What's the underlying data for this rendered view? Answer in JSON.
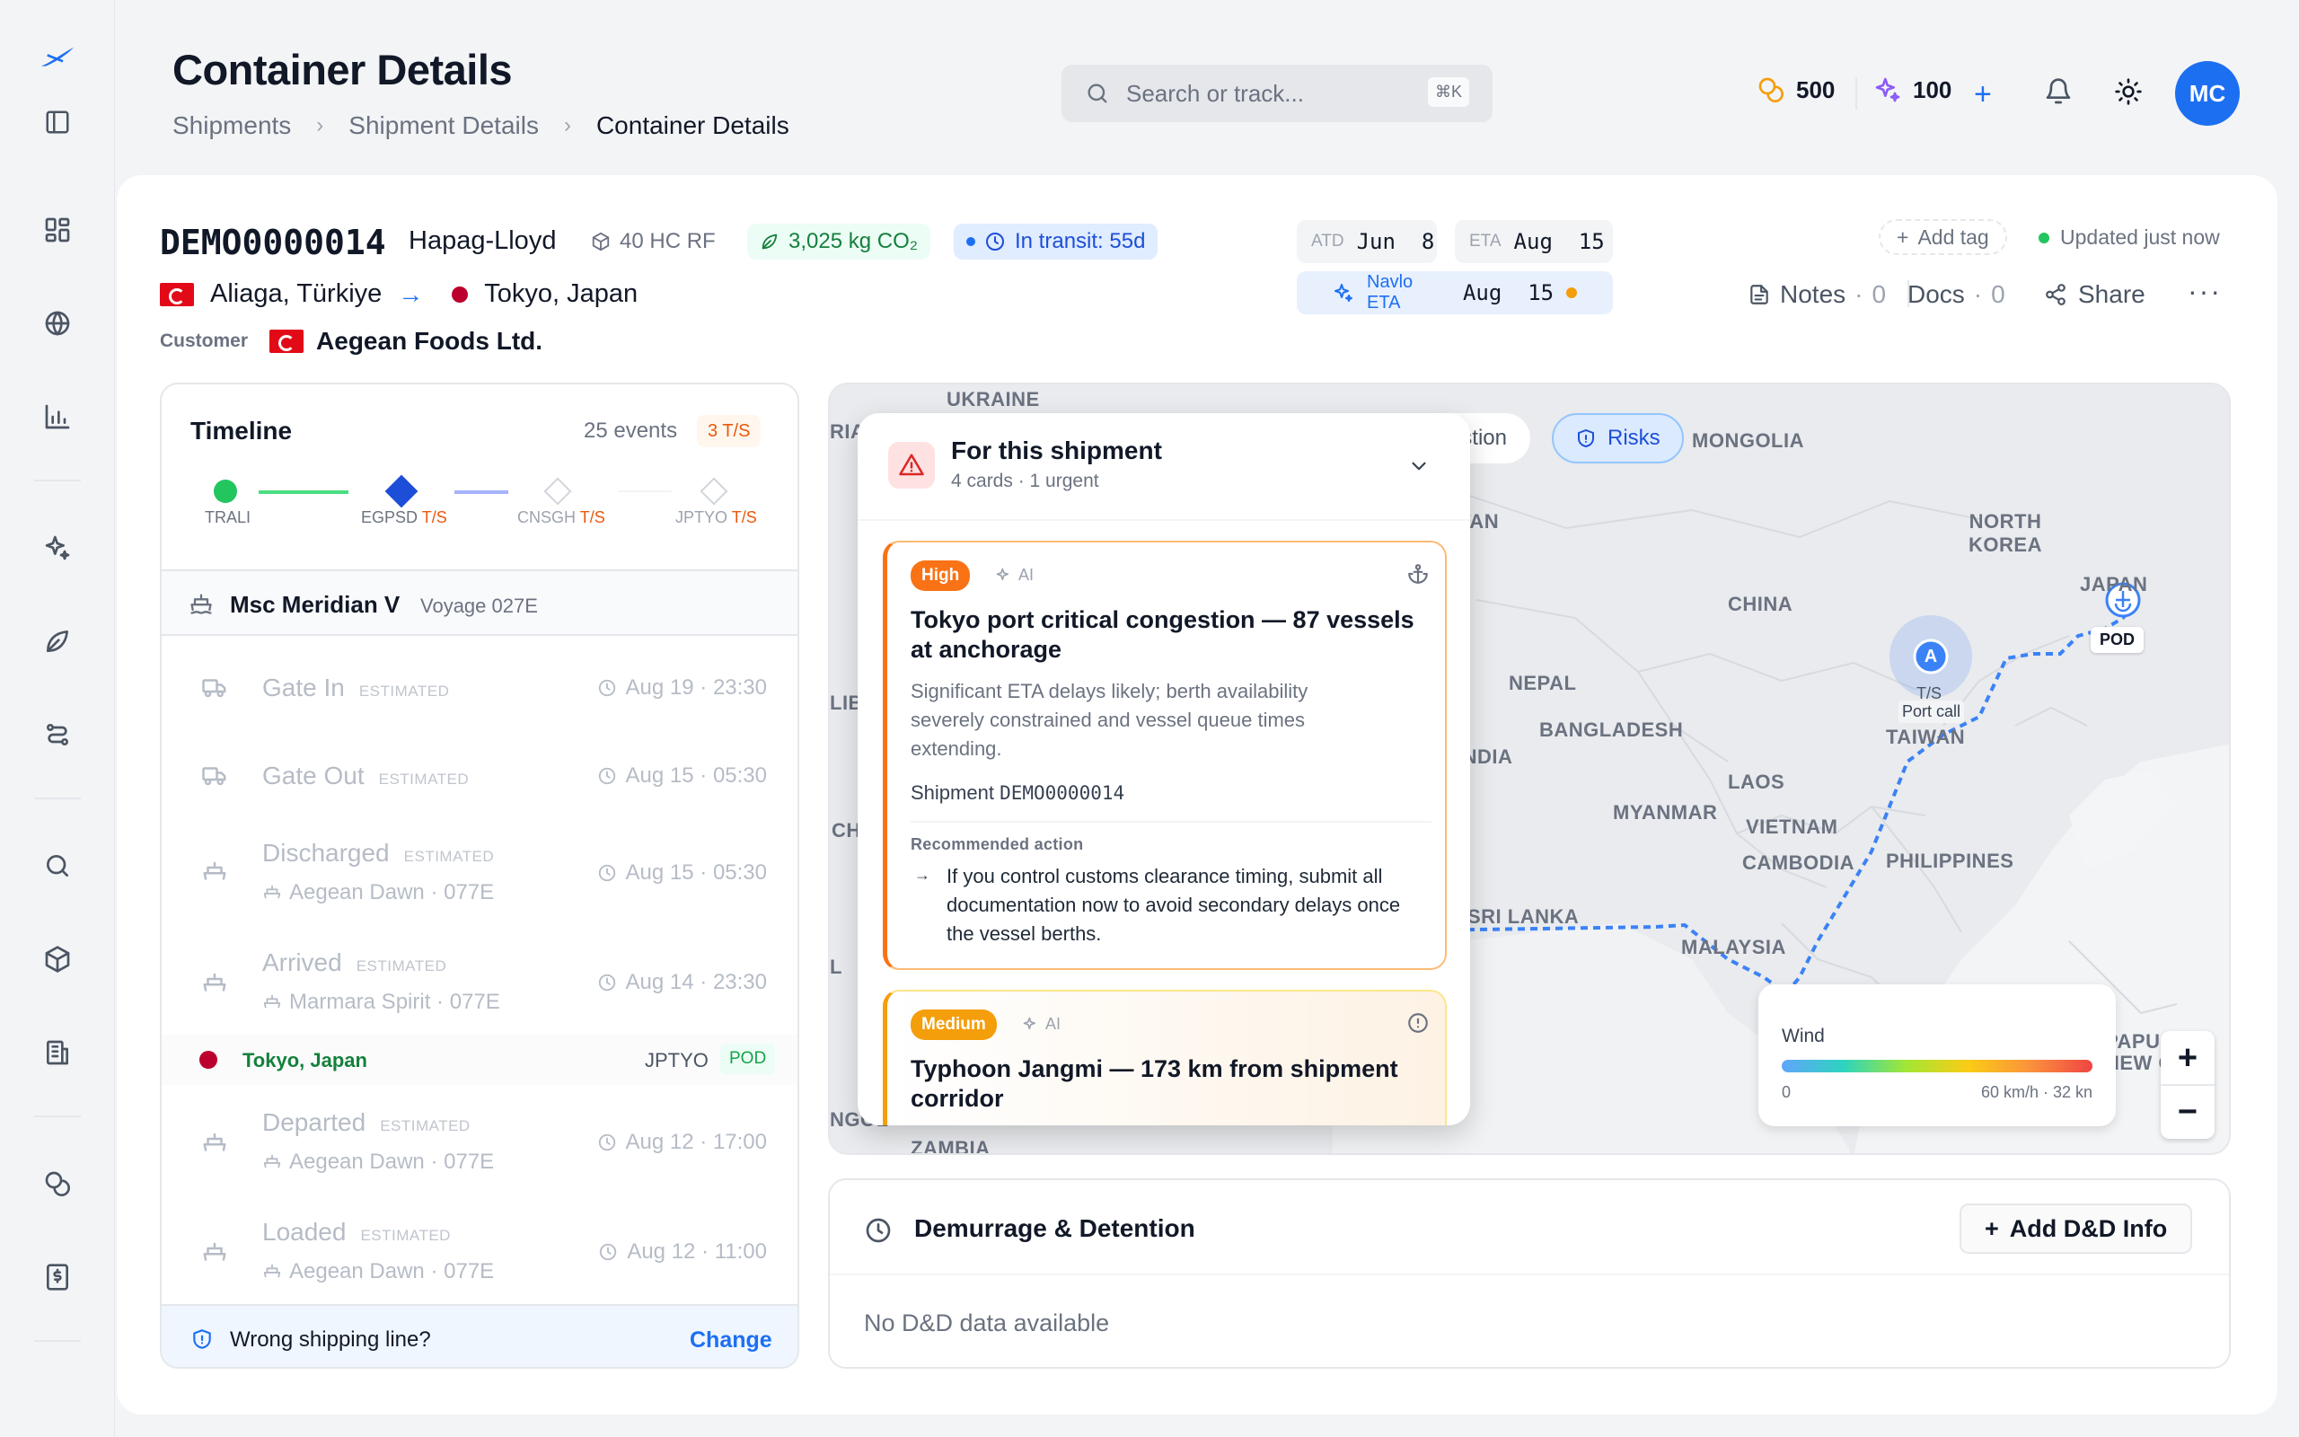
{
  "page": {
    "title": "Container Details"
  },
  "breadcrumb": [
    "Shipments",
    "Shipment Details",
    "Container Details"
  ],
  "search": {
    "placeholder": "Search or track...",
    "shortcut": "⌘K"
  },
  "header": {
    "coins": "500",
    "credits": "100",
    "avatar_initials": "MC"
  },
  "shipment": {
    "id": "DEMO0000014",
    "carrier": "Hapag-Lloyd",
    "container_type": "40 HC RF",
    "co2": "3,025 kg CO₂",
    "status": "In transit: 55d",
    "origin": "Aliaga, Türkiye",
    "destination": "Tokyo, Japan",
    "customer_label": "Customer",
    "customer": "Aegean Foods Ltd.",
    "atd_label": "ATD",
    "atd": "Jun  8",
    "eta_label": "ETA",
    "eta": "Aug  15",
    "navlo_eta_label": "Navlo ETA",
    "navlo_eta": "Aug  15",
    "add_tag": "Add tag",
    "updated": "Updated just now",
    "notes_label": "Notes",
    "notes_count": "0",
    "docs_label": "Docs",
    "docs_count": "0",
    "share_label": "Share"
  },
  "timeline": {
    "title": "Timeline",
    "events_count": "25 events",
    "ts_badge": "3 T/S",
    "ports": [
      {
        "code": "TRALI",
        "ts": ""
      },
      {
        "code": "EGPSD",
        "ts": "T/S"
      },
      {
        "code": "CNSGH",
        "ts": "T/S"
      },
      {
        "code": "JPTYO",
        "ts": "T/S"
      }
    ],
    "vessel": "Msc Meridian V",
    "voyage": "Voyage 027E",
    "estimated_tag": "ESTIMATED",
    "events": [
      {
        "name": "Gate In",
        "sub": "",
        "time": "Aug 19 · 23:30"
      },
      {
        "name": "Gate Out",
        "sub": "",
        "time": "Aug 15 · 05:30"
      },
      {
        "name": "Discharged",
        "sub": "Aegean Dawn · 077E",
        "time": "Aug 15 · 05:30"
      },
      {
        "name": "Arrived",
        "sub": "Marmara Spirit · 077E",
        "time": "Aug 14 · 23:30"
      }
    ],
    "location": {
      "name": "Tokyo, Japan",
      "code": "JPTYO",
      "badge": "POD"
    },
    "events2": [
      {
        "name": "Departed",
        "sub": "Aegean Dawn · 077E",
        "time": "Aug 12 · 17:00"
      },
      {
        "name": "Loaded",
        "sub": "Aegean Dawn · 077E",
        "time": "Aug 12 · 11:00"
      }
    ],
    "footer_question": "Wrong shipping line?",
    "footer_action": "Change"
  },
  "map": {
    "labels": [
      "UKRAINE",
      "MONGOLIA",
      "NORTH KOREA",
      "JAPAN",
      "CHINA",
      "NEPAL",
      "BANGLADESH",
      "INDIA",
      "LAOS",
      "MYANMAR",
      "VIETNAM",
      "TAIWAN",
      "CAMBODIA",
      "PHILIPPINES",
      "SRI LANKA",
      "MALAYSIA",
      "PAPUA NEW GU",
      "ZAMBIA",
      "TAN",
      "RIA",
      "LIB",
      "CH",
      "L",
      "NGOL"
    ],
    "tab_partial": "stion",
    "risks_tab": "Risks",
    "pod_label": "POD",
    "vessel_marker": "A",
    "ts_label": "T/S",
    "port_call_label": "Port call",
    "legend_title": "Wind",
    "legend_min": "0",
    "legend_max": "60 km/h · 32 kn",
    "zoom_in": "+",
    "zoom_out": "−"
  },
  "risk_panel": {
    "title": "For this shipment",
    "subtitle": "4 cards · 1 urgent",
    "cards": [
      {
        "severity": "High",
        "ai": "AI",
        "title": "Tokyo port critical congestion — 87 vessels at anchorage",
        "body": "Significant ETA delays likely; berth availability severely constrained and vessel queue times extending.",
        "shipment_label": "Shipment",
        "shipment_id": "DEMO0000014",
        "action_label": "Recommended action",
        "action": "If you control customs clearance timing, submit all documentation now to avoid secondary delays once the vessel berths."
      },
      {
        "severity": "Medium",
        "ai": "AI",
        "title": "Typhoon Jangmi — 173 km from shipment corridor"
      }
    ]
  },
  "dd": {
    "title": "Demurrage & Detention",
    "button": "Add D&D Info",
    "empty": "No D&D data available"
  },
  "colors": {
    "accent": "#1d6ff2",
    "high": "#f97316",
    "medium": "#f59e0b",
    "green": "#16a34a",
    "brand_red": "#e30a17"
  }
}
